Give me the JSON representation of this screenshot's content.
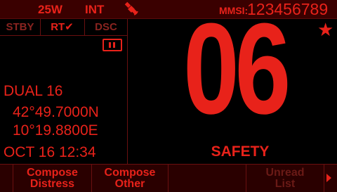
{
  "topbar": {
    "power": "25W",
    "mode": "INT",
    "gps_icon": "satellite-icon",
    "mmsi_label": "MMSI:",
    "mmsi": "123456789"
  },
  "modes": {
    "stby": "STBY",
    "rt": "RT✔",
    "dsc": "DSC"
  },
  "status": {
    "watch": "DUAL 16",
    "latitude": "42°49.7000N",
    "longitude": "10°19.8800E",
    "datetime": "OCT 16 12:34"
  },
  "channel": {
    "number": "06",
    "label": "SAFETY",
    "favorite_icon": "star-icon"
  },
  "softkeys": {
    "key1_line1": "Compose",
    "key1_line2": "Distress",
    "key2_line1": "Compose",
    "key2_line2": "Other",
    "key3": "",
    "key4_line1": "Unread",
    "key4_line2": "List",
    "next_icon": "chevron-right-icon"
  },
  "colors": {
    "accent": "#e8221a",
    "background": "#000000",
    "bar": "#3a0000"
  }
}
